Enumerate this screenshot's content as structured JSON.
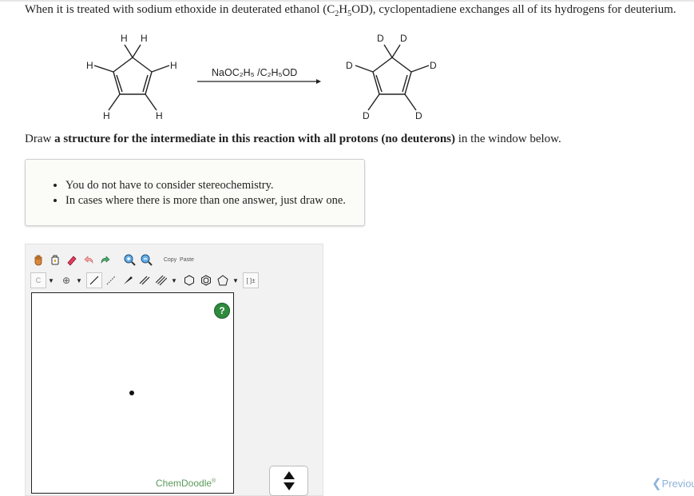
{
  "question": {
    "intro_before": "When it is treated with sodium ethoxide in deuterated ethanol (C",
    "intro_sub1": "2",
    "intro_mid1": "H",
    "intro_sub2": "5",
    "intro_after": "OD), cyclopentadiene exchanges all of its hydrogens for deuterium."
  },
  "reaction": {
    "reagent": "NaOC₂H₅ /C₂H₅OD",
    "reactant_label": "H",
    "product_label": "D"
  },
  "instruction": {
    "prefix": "Draw ",
    "bold": "a structure for the intermediate in this reaction with all protons (no deuterons)",
    "suffix": " in the window below."
  },
  "hints": [
    "You do not have to consider stereochemistry.",
    "In cases where there is more than one answer, just draw one."
  ],
  "editor": {
    "help_label": "?",
    "brand": "ChemDoodle",
    "brand_mark": "®",
    "copy_label": "Copy",
    "paste_label": "Paste",
    "element_label": "C",
    "bracket_label": "[ ]±"
  },
  "nav": {
    "previous_label": "Previous"
  }
}
